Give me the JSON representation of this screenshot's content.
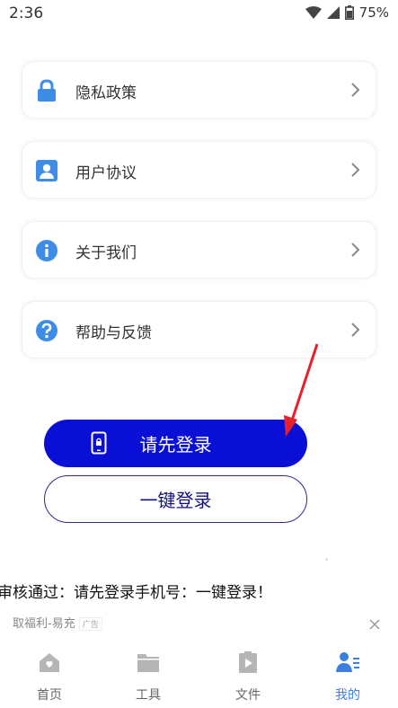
{
  "status_bar": {
    "time": "2:36",
    "battery": "75%"
  },
  "menu": [
    {
      "label": "隐私政策",
      "icon": "lock-icon"
    },
    {
      "label": "用户协议",
      "icon": "user-card-icon"
    },
    {
      "label": "关于我们",
      "icon": "info-icon"
    },
    {
      "label": "帮助与反馈",
      "icon": "help-icon"
    }
  ],
  "login": {
    "primary_label": "请先登录",
    "secondary_label": "一键登录"
  },
  "notice": "审核通过：请先登录手机号：一键登录！",
  "ad": {
    "text": "取福利-易充",
    "badge": "广告"
  },
  "nav": [
    {
      "label": "首页",
      "icon": "home-icon"
    },
    {
      "label": "工具",
      "icon": "folder-icon"
    },
    {
      "label": "文件",
      "icon": "file-play-icon"
    },
    {
      "label": "我的",
      "icon": "profile-icon",
      "active": true
    }
  ],
  "colors": {
    "accent": "#3b7fe0",
    "primary_button": "#0a0fd6",
    "arrow": "#e8202a"
  }
}
